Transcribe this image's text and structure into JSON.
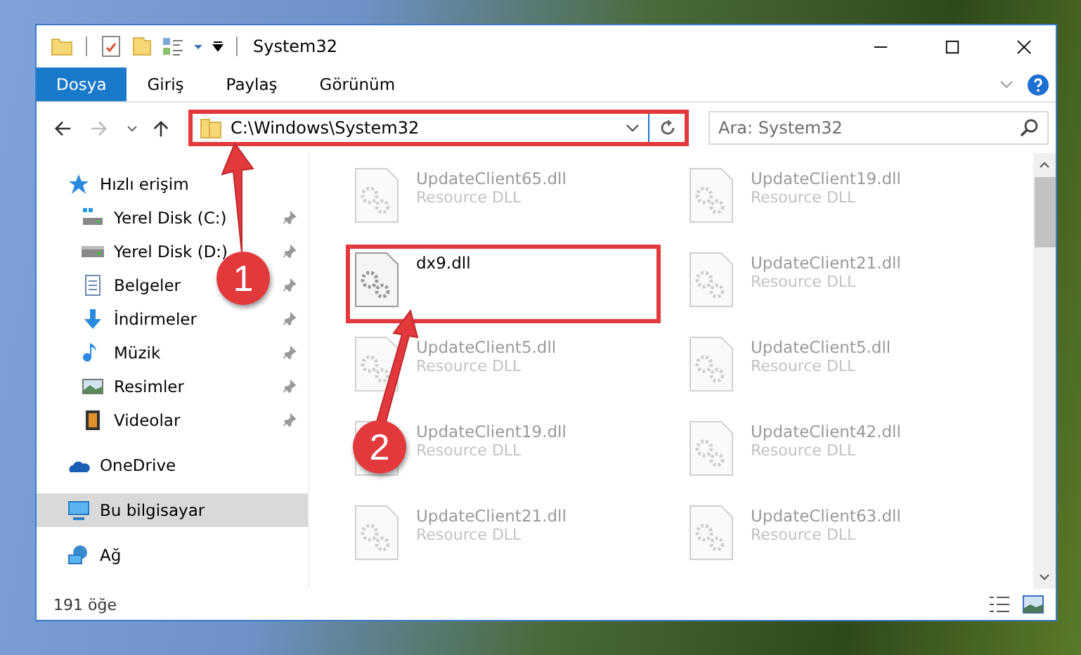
{
  "window": {
    "title": "System32"
  },
  "ribbon": {
    "tabs": [
      {
        "label": "Dosya",
        "kind": "file_menu"
      },
      {
        "label": "Giriş",
        "kind": "tab"
      },
      {
        "label": "Paylaş",
        "kind": "tab"
      },
      {
        "label": "Görünüm",
        "kind": "tab"
      }
    ]
  },
  "address_bar": {
    "path": "C:\\Windows\\System32",
    "highlighted": true
  },
  "search": {
    "placeholder": "Ara: System32"
  },
  "sidebar": {
    "items": [
      {
        "label": "Hızlı erişim",
        "kind": "star",
        "selected": false,
        "children": [
          {
            "label": "Yerel Disk (C:)",
            "kind": "system_drive",
            "pinned": true
          },
          {
            "label": "Yerel Disk (D:)",
            "kind": "drive",
            "pinned": true
          },
          {
            "label": "Belgeler",
            "kind": "document",
            "pinned": true
          },
          {
            "label": "İndirmeler",
            "kind": "download",
            "pinned": true
          },
          {
            "label": "Müzik",
            "kind": "music",
            "pinned": true
          },
          {
            "label": "Resimler",
            "kind": "picture",
            "pinned": true
          },
          {
            "label": "Videolar",
            "kind": "video",
            "pinned": true
          }
        ]
      },
      {
        "label": "OneDrive",
        "kind": "cloud",
        "selected": false
      },
      {
        "label": "Bu bilgisayar",
        "kind": "computer",
        "selected": true
      },
      {
        "label": "Ağ",
        "kind": "network",
        "selected": false
      }
    ]
  },
  "files": [
    {
      "name": "UpdateClient65.dll",
      "type": "Resource DLL",
      "blurred": true,
      "highlighted": false
    },
    {
      "name": "dx9.dll",
      "blurred": false,
      "highlighted": true
    },
    {
      "name": "UpdateClient5.dll",
      "type": "Resource DLL",
      "blurred": true,
      "highlighted": false
    },
    {
      "name": "UpdateClient19.dll",
      "type": "Resource DLL",
      "blurred": true,
      "highlighted": false
    },
    {
      "name": "UpdateClient21.dll",
      "type": "Resource DLL",
      "blurred": true,
      "highlighted": false
    },
    {
      "name": "UpdateClient19.dll",
      "type": "Resource DLL",
      "blurred": true,
      "highlighted": false
    },
    {
      "name": "UpdateClient21.dll",
      "type": "Resource DLL",
      "blurred": true,
      "highlighted": false
    },
    {
      "name": "UpdateClient5.dll",
      "type": "Resource DLL",
      "blurred": true,
      "highlighted": false
    },
    {
      "name": "UpdateClient42.dll",
      "type": "Resource DLL",
      "blurred": true,
      "highlighted": false
    },
    {
      "name": "UpdateClient63.dll",
      "type": "Resource DLL",
      "blurred": true,
      "highlighted": false
    }
  ],
  "status_bar": {
    "count": "191 öğe"
  },
  "annotations": [
    {
      "label": "1"
    },
    {
      "label": "2"
    }
  ]
}
